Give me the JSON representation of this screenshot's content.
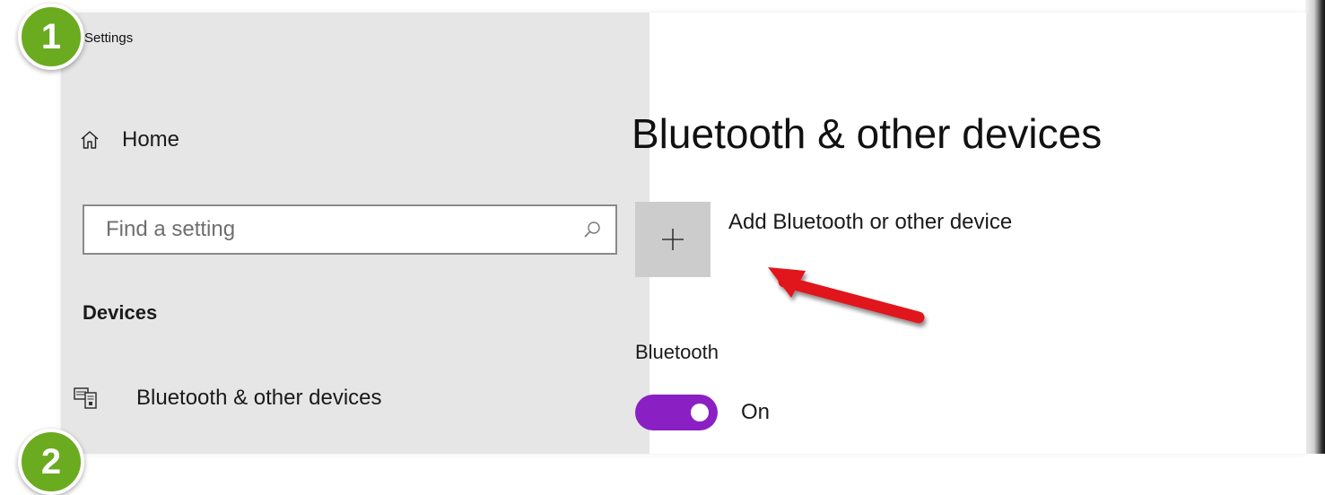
{
  "window": {
    "title": "Settings"
  },
  "sidebar": {
    "home_label": "Home",
    "search": {
      "placeholder": "Find a setting",
      "value": ""
    },
    "section_heading": "Devices",
    "items": [
      {
        "label": "Bluetooth & other devices",
        "icon": "bluetooth-devices-icon"
      }
    ]
  },
  "main": {
    "title": "Bluetooth & other devices",
    "add_device_label": "Add Bluetooth or other device",
    "bluetooth_label": "Bluetooth",
    "bluetooth_toggle": {
      "state": "On",
      "on": true
    }
  },
  "annotations": {
    "step_badges": [
      "1",
      "2"
    ]
  },
  "colors": {
    "sidebar_bg": "#e6e6e6",
    "accent": "#8a1fc4",
    "tile_bg": "#cccccc",
    "badge": "#6aab1f",
    "arrow": "#e0191b"
  }
}
